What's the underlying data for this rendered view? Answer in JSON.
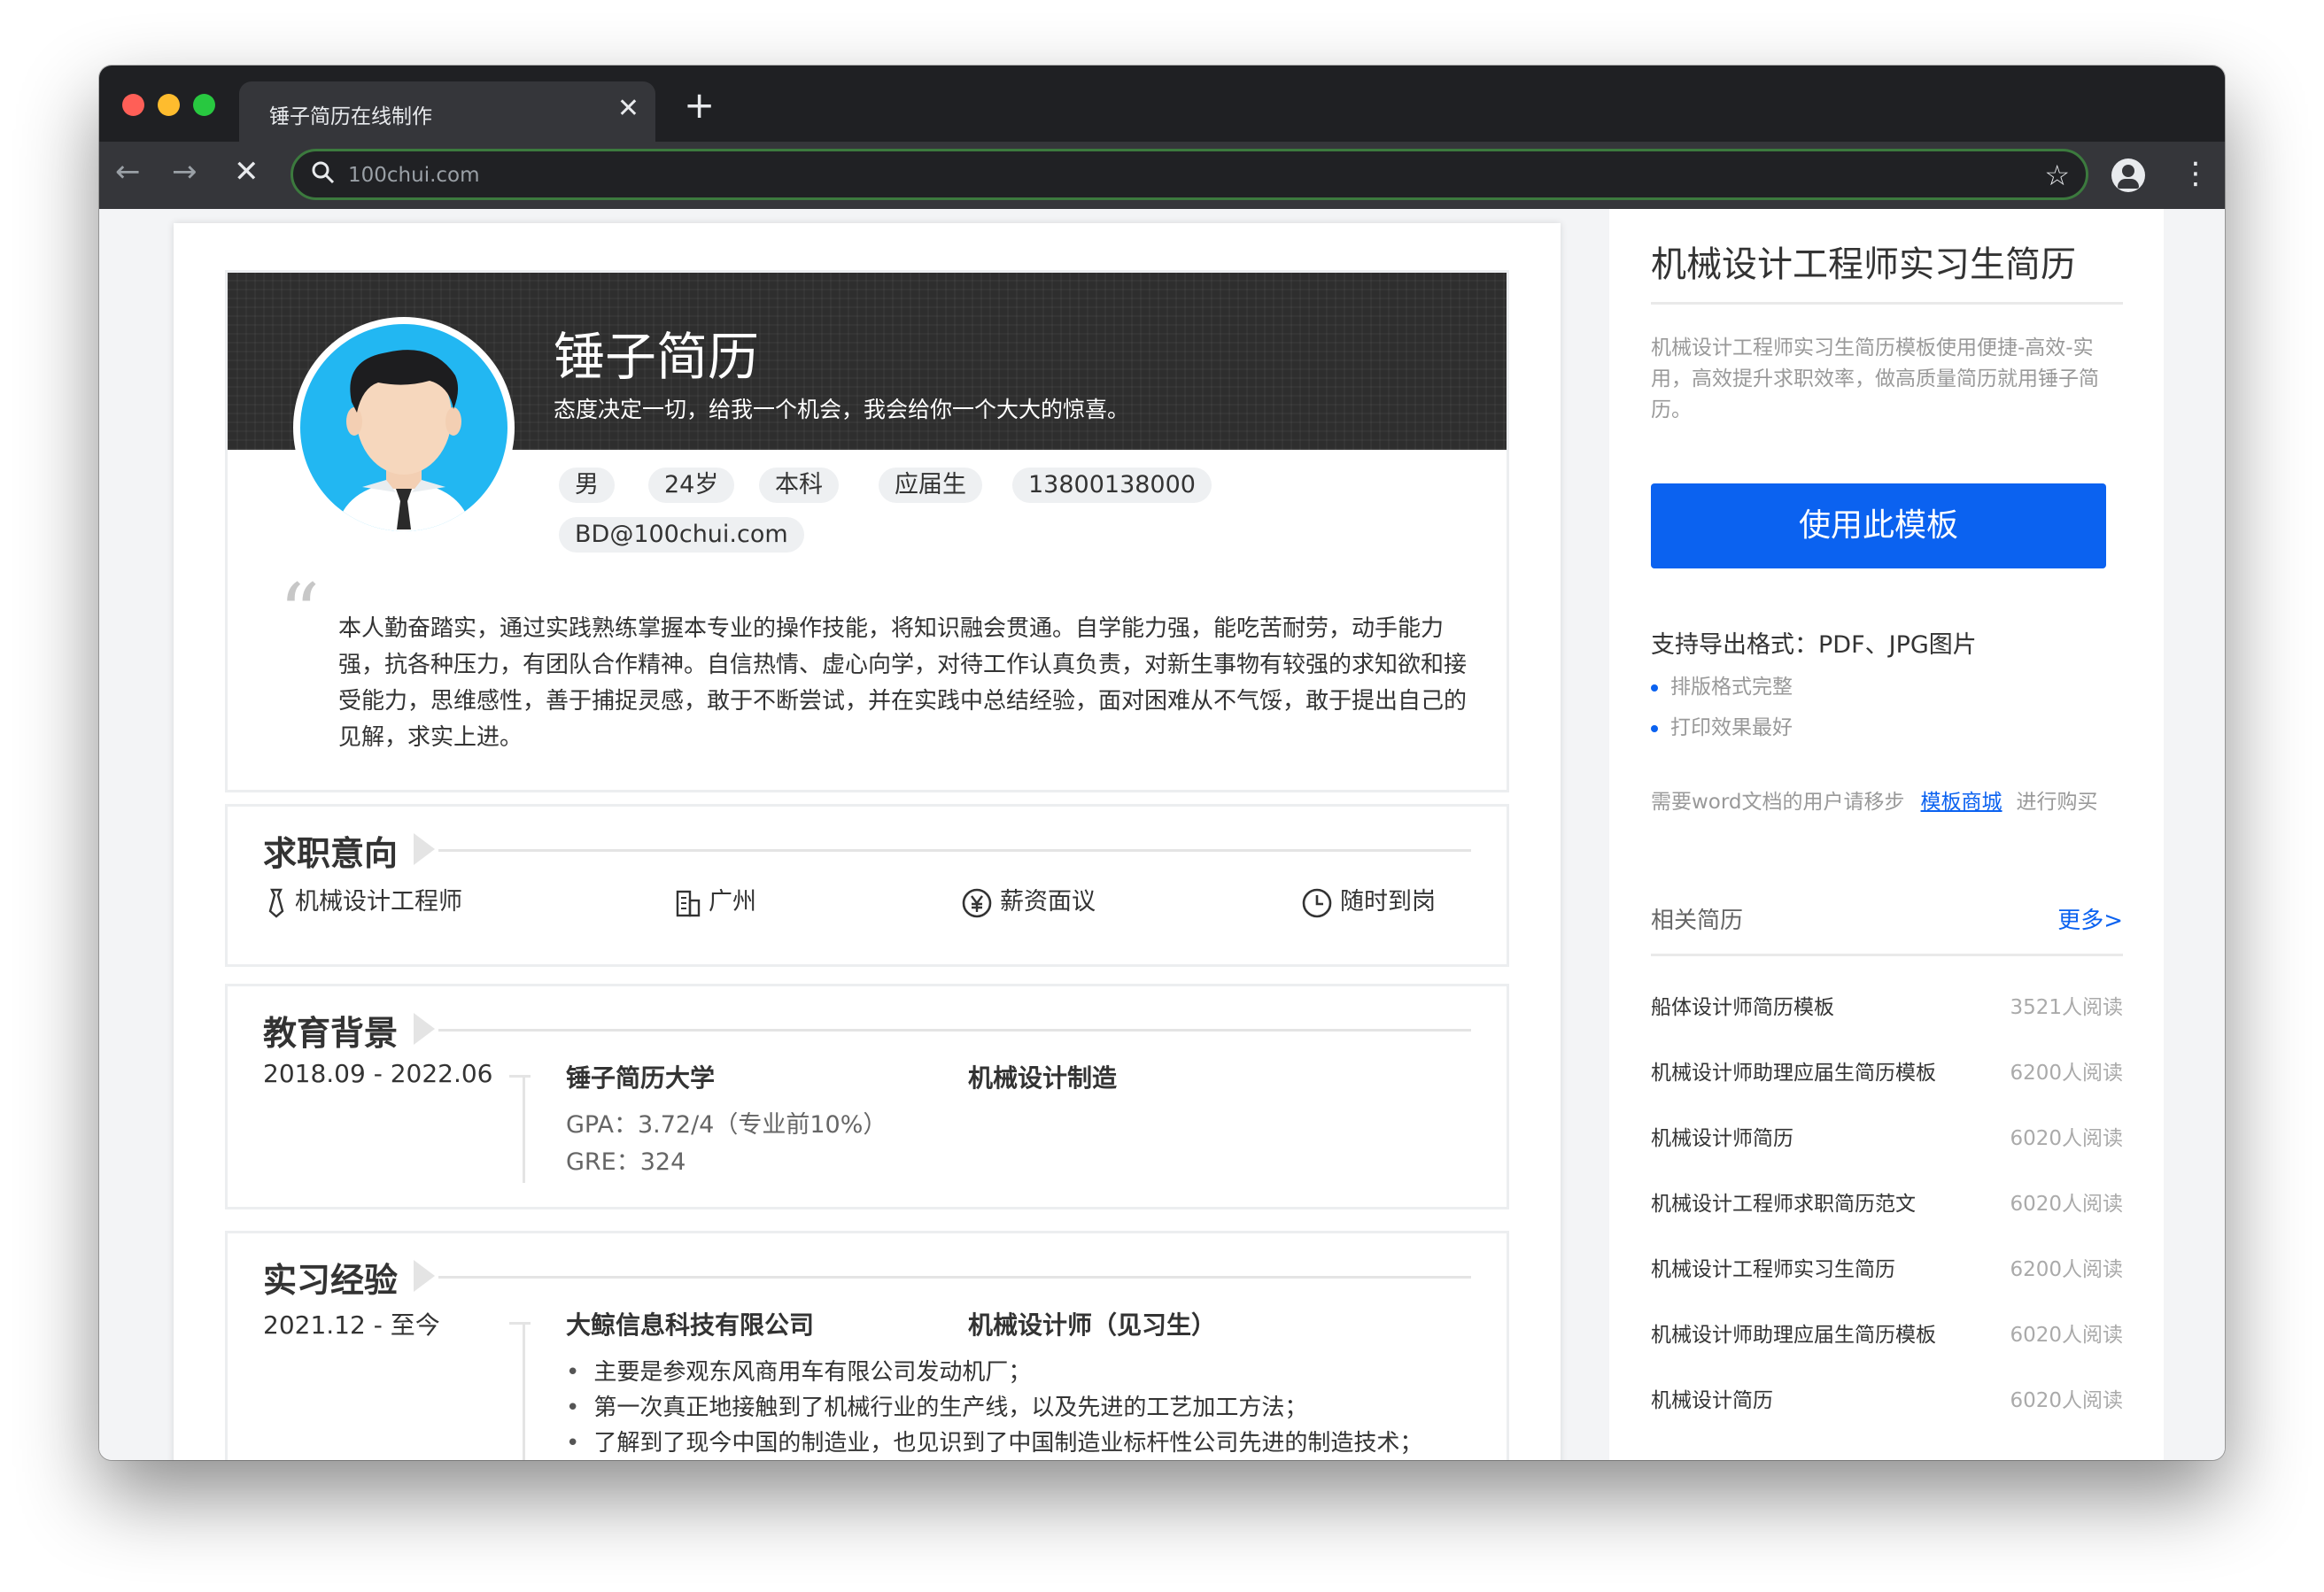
{
  "browser": {
    "tab_title": "锤子简历在线制作",
    "close_glyph": "✕",
    "new_tab_glyph": "+",
    "url": "100chui.com",
    "nav_back": "←",
    "nav_forward": "→",
    "nav_stop": "✕",
    "star_glyph": "☆",
    "menu_glyph": "⋮",
    "search_glyph": "⌕",
    "traffic_lights": [
      "#ff5f57",
      "#febc2e",
      "#28c840"
    ]
  },
  "resume": {
    "name": "锤子简历",
    "motto": "态度决定一切，给我一个机会，我会给你一个大大的惊喜。",
    "chips": [
      "男",
      "24岁",
      "本科",
      "应届生",
      "13800138000"
    ],
    "email": "BD@100chui.com",
    "quote_glyph": "“",
    "summary": "本人勤奋踏实，通过实践熟练掌握本专业的操作技能，将知识融会贯通。自学能力强，能吃苦耐劳，动手能力强，抗各种压力，有团队合作精神。自信热情、虚心向学，对待工作认真负责，对新生事物有较强的求知欲和接受能力，思维感性，善于捕捉灵感，敢于不断尝试，并在实践中总结经验，面对困难从不气馁，敢于提出自己的见解，求实上进。",
    "intent": {
      "title": "求职意向",
      "position": "机械设计工程师",
      "city": "广州",
      "salary": "薪资面议",
      "availability": "随时到岗"
    },
    "education": {
      "title": "教育背景",
      "date": "2018.09 - 2022.06",
      "school": "锤子简历大学",
      "major": "机械设计制造",
      "gpa": "GPA：3.72/4（专业前10%）",
      "gre": "GRE：324"
    },
    "internship": {
      "title": "实习经验",
      "date": "2021.12 - 至今",
      "company": "大鲸信息科技有限公司",
      "role": "机械设计师（见习生）",
      "bullets": [
        "主要是参观东风商用车有限公司发动机厂；",
        "第一次真正地接触到了机械行业的生产线，以及先进的工艺加工方法；",
        "了解到了现今中国的制造业，也见识到了中国制造业标杆性公司先进的制造技术；"
      ]
    }
  },
  "sidebar": {
    "title": "机械设计工程师实习生简历",
    "description": "机械设计工程师实习生简历模板使用便捷-高效-实用，高效提升求职效率，做高质量简历就用锤子简历。",
    "use_button": "使用此模板",
    "export_label": "支持导出格式：PDF、JPG图片",
    "features": [
      "排版格式完整",
      "打印效果最好"
    ],
    "word_prefix": "需要word文档的用户请移步",
    "word_link": "模板商城",
    "word_suffix": "进行购买",
    "related_title": "相关简历",
    "related_more": "更多>",
    "related": [
      {
        "name": "船体设计师简历模板",
        "reads": "3521人阅读"
      },
      {
        "name": "机械设计师助理应届生简历模板",
        "reads": "6200人阅读"
      },
      {
        "name": "机械设计师简历",
        "reads": "6020人阅读"
      },
      {
        "name": "机械设计工程师求职简历范文",
        "reads": "6020人阅读"
      },
      {
        "name": "机械设计工程师实习生简历",
        "reads": "6200人阅读"
      },
      {
        "name": "机械设计师助理应届生简历模板",
        "reads": "6020人阅读"
      },
      {
        "name": "机械设计简历",
        "reads": "6020人阅读"
      }
    ]
  },
  "colors": {
    "accent": "#0b62f0",
    "avatar_bg": "#22b7f2",
    "banner": "#2e2e2e"
  }
}
